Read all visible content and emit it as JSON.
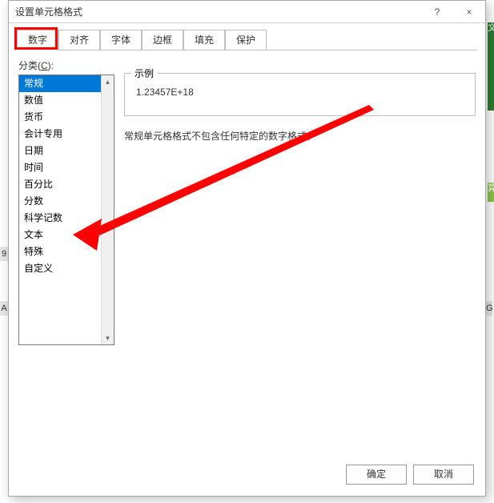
{
  "dialog": {
    "title": "设置单元格格式",
    "help_symbol": "?",
    "close_symbol": "×"
  },
  "tabs": [
    {
      "label": "数字",
      "active": true
    },
    {
      "label": "对齐",
      "active": false
    },
    {
      "label": "字体",
      "active": false
    },
    {
      "label": "边框",
      "active": false
    },
    {
      "label": "填充",
      "active": false
    },
    {
      "label": "保护",
      "active": false
    }
  ],
  "category": {
    "label_prefix": "分类(",
    "label_hotkey": "C",
    "label_suffix": "):",
    "items": [
      "常规",
      "数值",
      "货币",
      "会计专用",
      "日期",
      "时间",
      "百分比",
      "分数",
      "科学记数",
      "文本",
      "特殊",
      "自定义"
    ],
    "selected_index": 0
  },
  "preview": {
    "legend": "示例",
    "value": "1.23457E+18"
  },
  "description": "常规单元格格式不包含任何特定的数字格式。",
  "buttons": {
    "ok": "确定",
    "cancel": "取消"
  },
  "background": {
    "col_header_A": "A",
    "col_header_G": "G",
    "row_label": "9",
    "ribbon_char_1": "文",
    "ribbon_char_2": "算"
  },
  "scroll": {
    "up": "▴",
    "down": "▾"
  }
}
